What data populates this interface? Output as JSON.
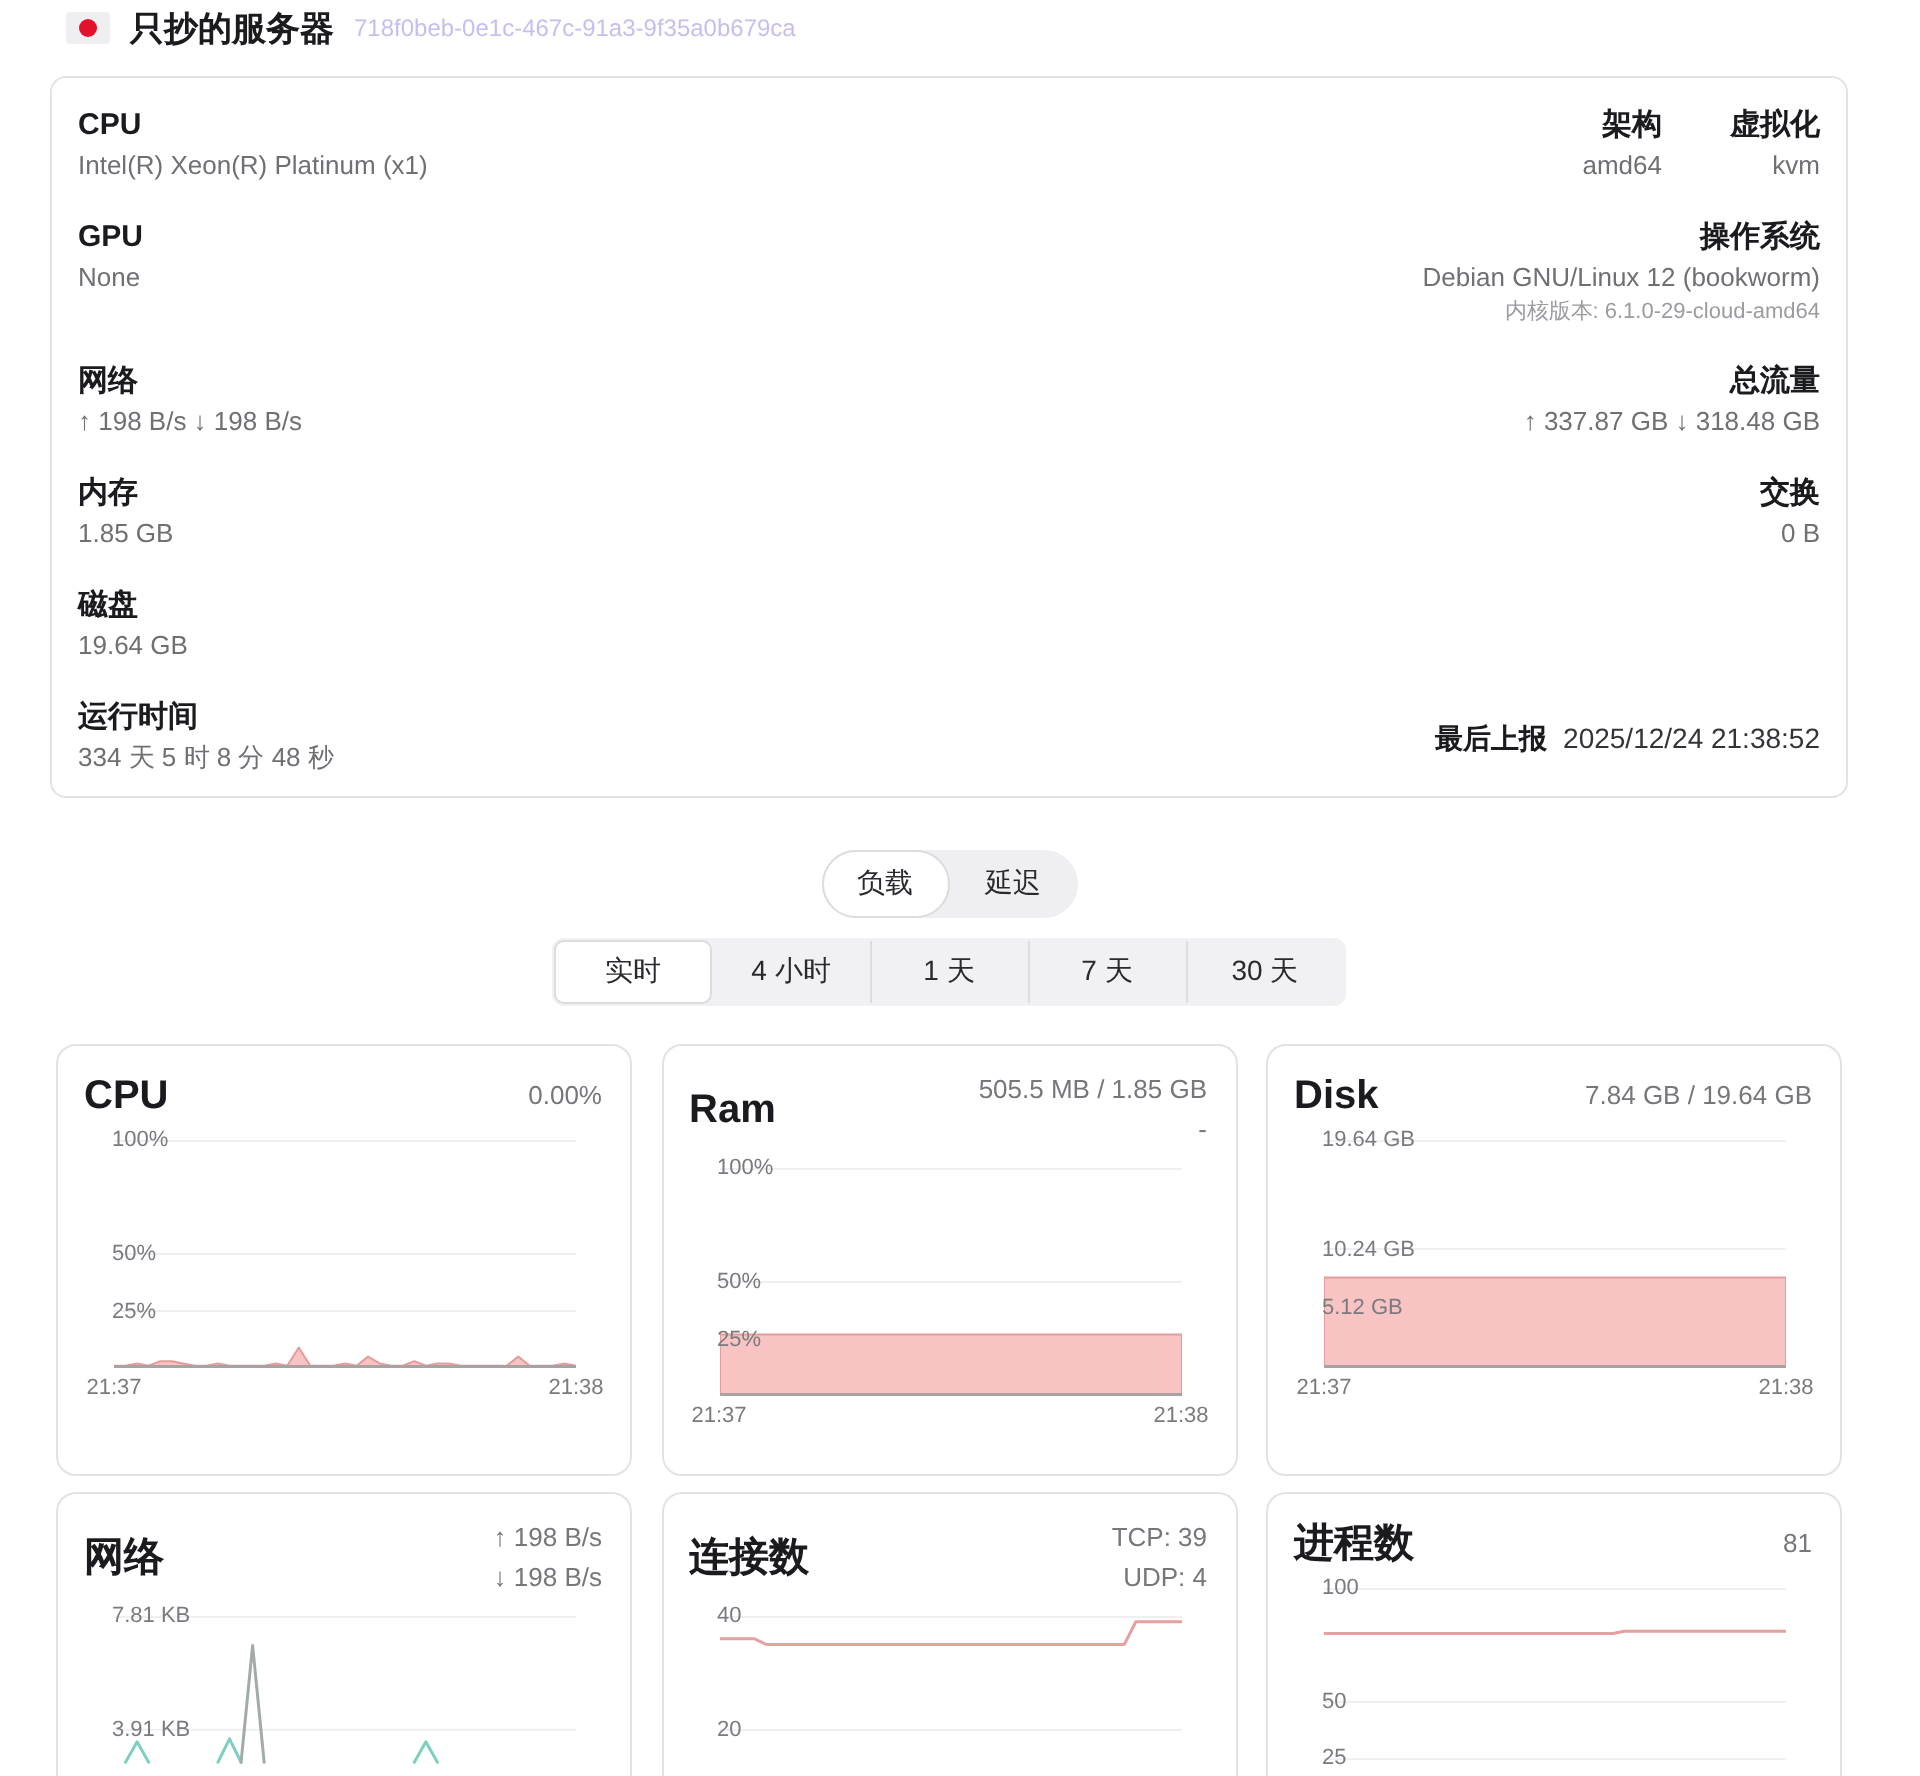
{
  "header": {
    "title": "只抄的服务器",
    "uuid": "718f0beb-0e1c-467c-91a3-9f35a0b679ca"
  },
  "details": [
    {
      "left": {
        "label": "CPU",
        "value": "Intel(R) Xeon(R) Platinum (x1)"
      },
      "right": [
        {
          "kind": "stacked",
          "label": "架构",
          "value": "amd64"
        },
        {
          "kind": "stacked",
          "label": "虚拟化",
          "value": "kvm"
        }
      ]
    },
    {
      "left": {
        "label": "GPU",
        "value": "None"
      },
      "right": [
        {
          "kind": "stacked",
          "label": "操作系统",
          "value": "Debian GNU/Linux 12 (bookworm)",
          "note": "内核版本: 6.1.0-29-cloud-amd64"
        }
      ]
    },
    {
      "left": {
        "label": "网络",
        "value": "↑ 198 B/s ↓ 198 B/s"
      },
      "right": [
        {
          "kind": "stacked",
          "label": "总流量",
          "value": "↑ 337.87 GB ↓ 318.48 GB"
        }
      ]
    },
    {
      "left": {
        "label": "内存",
        "value": "1.85 GB"
      },
      "right": [
        {
          "kind": "stacked",
          "label": "交换",
          "value": "0 B"
        }
      ]
    },
    {
      "left": {
        "label": "磁盘",
        "value": "19.64 GB"
      }
    },
    {
      "left": {
        "label": "运行时间",
        "value": "334 天 5 时 8 分 48 秒"
      },
      "right": [
        {
          "kind": "inline",
          "label": "最后上报",
          "value": "2025/12/24 21:38:52"
        }
      ]
    }
  ],
  "view_tabs": [
    {
      "label": "负载",
      "selected": true
    },
    {
      "label": "延迟",
      "selected": false
    }
  ],
  "range_tabs": [
    {
      "label": "实时",
      "selected": true
    },
    {
      "label": "4 小时",
      "selected": false
    },
    {
      "label": "1 天",
      "selected": false
    },
    {
      "label": "7 天",
      "selected": false
    },
    {
      "label": "30 天",
      "selected": false
    }
  ],
  "charts": [
    {
      "title": "CPU",
      "readings": [
        "0.00%"
      ],
      "chart_data": {
        "type": "area",
        "categories": [
          "21:37",
          null,
          null,
          null,
          null,
          null,
          null,
          null,
          null,
          null,
          null,
          null,
          null,
          null,
          null,
          null,
          null,
          null,
          null,
          null,
          null,
          null,
          null,
          null,
          null,
          null,
          null,
          null,
          null,
          null,
          null,
          null,
          null,
          null,
          null,
          null,
          null,
          null,
          null,
          null,
          "21:38"
        ],
        "ylim": [
          0,
          100
        ],
        "yticks": [
          {
            "value": 100,
            "label": "100%"
          },
          {
            "value": 50,
            "label": "50%"
          },
          {
            "value": 25,
            "label": "25%"
          }
        ],
        "series": [
          {
            "color": "#f7c3c3",
            "values": [
              1,
              1,
              2,
              1,
              3,
              3,
              2,
              1,
              1,
              2,
              1,
              1,
              1,
              1,
              2,
              1,
              9,
              1,
              1,
              1,
              2,
              1,
              5,
              2,
              1,
              1,
              3,
              1,
              2,
              2,
              1,
              1,
              1,
              1,
              1,
              5,
              1,
              1,
              1,
              2,
              1
            ]
          }
        ]
      }
    },
    {
      "title": "Ram",
      "readings": [
        "505.5 MB / 1.85 GB",
        "-"
      ],
      "chart_data": {
        "type": "area",
        "categories": [
          "21:37",
          null,
          null,
          null,
          null,
          null,
          null,
          null,
          null,
          null,
          "21:38"
        ],
        "ylim": [
          0,
          100
        ],
        "yticks": [
          {
            "value": 100,
            "label": "100%"
          },
          {
            "value": 50,
            "label": "50%"
          },
          {
            "value": 25,
            "label": "25%"
          }
        ],
        "series": [
          {
            "color": "#f7c3c3",
            "values": [
              27,
              27,
              27,
              27,
              27,
              27,
              27,
              27,
              27,
              27,
              27
            ]
          }
        ]
      }
    },
    {
      "title": "Disk",
      "readings": [
        "7.84 GB / 19.64 GB"
      ],
      "chart_data": {
        "type": "area",
        "categories": [
          "21:37",
          null,
          null,
          null,
          null,
          null,
          null,
          null,
          null,
          null,
          "21:38"
        ],
        "ylim": [
          0,
          19.64
        ],
        "yticks": [
          {
            "value": 19.64,
            "label": "19.64 GB"
          },
          {
            "value": 10.24,
            "label": "10.24 GB"
          },
          {
            "value": 5.12,
            "label": "5.12 GB"
          }
        ],
        "series": [
          {
            "color": "#f7c3c3",
            "values": [
              7.8,
              7.8,
              7.8,
              7.8,
              7.8,
              7.8,
              7.8,
              7.8,
              7.8,
              7.8,
              7.8
            ]
          }
        ]
      }
    },
    {
      "title": "网络",
      "readings": [
        "↑ 198 B/s",
        "↓ 198 B/s"
      ],
      "chart_data": {
        "type": "line",
        "ylim": [
          2.33,
          7.81
        ],
        "yticks": [
          {
            "value": 7.81,
            "label": "7.81 KB"
          },
          {
            "value": 3.91,
            "label": "3.91 KB"
          }
        ],
        "series": [
          {
            "color": "#7fcfc0",
            "values": [
              null,
              2.8,
              3.5,
              2.8,
              null,
              null,
              null,
              null,
              null,
              2.8,
              3.6,
              2.8,
              null,
              null,
              null,
              null,
              null,
              null,
              null,
              null,
              null,
              null,
              null,
              null,
              null,
              null,
              2.8,
              3.5,
              2.8,
              null,
              null,
              null,
              null,
              null,
              null,
              null,
              null,
              null,
              null,
              null,
              null
            ]
          },
          {
            "color": "#a3aba8",
            "values": [
              null,
              null,
              null,
              null,
              null,
              null,
              null,
              null,
              null,
              null,
              null,
              2.8,
              6.8,
              2.8,
              null,
              null,
              null,
              null,
              null,
              null,
              null,
              null,
              null,
              null,
              null,
              null,
              null,
              null,
              null,
              null,
              null,
              null,
              null,
              null,
              null,
              null,
              null,
              null,
              null,
              null,
              null
            ]
          }
        ]
      }
    },
    {
      "title": "连接数",
      "readings": [
        "TCP: 39",
        "UDP: 4"
      ],
      "chart_data": {
        "type": "line",
        "ylim": [
          11.9,
          40
        ],
        "yticks": [
          40,
          20
        ],
        "series": [
          {
            "color": "#e6a0a0",
            "values": [
              36,
              36,
              36,
              36,
              35,
              35,
              35,
              35,
              35,
              35,
              35,
              35,
              35,
              35,
              35,
              35,
              35,
              35,
              35,
              35,
              35,
              35,
              35,
              35,
              35,
              35,
              35,
              35,
              35,
              35,
              35,
              35,
              35,
              35,
              35,
              35,
              39,
              39,
              39,
              39,
              39
            ]
          }
        ]
      }
    },
    {
      "title": "进程数",
      "readings": [
        "81"
      ],
      "chart_data": {
        "type": "line",
        "ylim": [
          17.5,
          100
        ],
        "yticks": [
          100,
          50,
          25
        ],
        "series": [
          {
            "color": "#e6a0a0",
            "values": [
              80,
              80,
              80,
              80,
              80,
              80,
              80,
              80,
              80,
              80,
              80,
              80,
              80,
              80,
              80,
              80,
              80,
              80,
              80,
              80,
              80,
              80,
              80,
              80,
              80,
              80,
              81,
              81,
              81,
              81,
              81,
              81,
              81,
              81,
              81,
              81,
              81,
              81,
              81,
              81,
              81
            ]
          }
        ]
      }
    }
  ]
}
